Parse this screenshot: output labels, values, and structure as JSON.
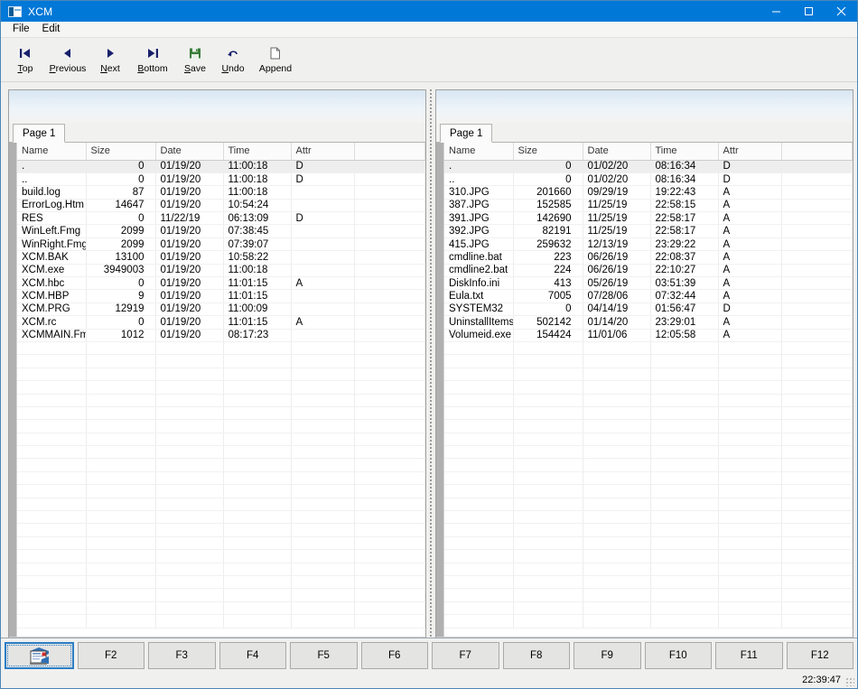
{
  "window": {
    "title": "XCM",
    "icon": "app-window-icon",
    "border_color": "#4a86b8",
    "titlebar_color": "#0078d7",
    "controls": [
      {
        "name": "minimize-button",
        "glyph": "minimize-icon"
      },
      {
        "name": "maximize-button",
        "glyph": "maximize-icon"
      },
      {
        "name": "close-button",
        "glyph": "close-icon"
      }
    ]
  },
  "menubar": {
    "items": [
      {
        "label": "File",
        "name": "menu-file"
      },
      {
        "label": "Edit",
        "name": "menu-edit"
      }
    ]
  },
  "toolbar": {
    "buttons": [
      {
        "label": "Top",
        "accel": "T",
        "icon": "first-page-icon"
      },
      {
        "label": "Previous",
        "accel": "P",
        "icon": "previous-icon"
      },
      {
        "label": "Next",
        "accel": "N",
        "icon": "next-icon"
      },
      {
        "label": "Bottom",
        "accel": "B",
        "icon": "last-page-icon"
      },
      {
        "label": "Save",
        "accel": "S",
        "icon": "floppy-save-icon"
      },
      {
        "label": "Undo",
        "accel": "U",
        "icon": "undo-icon"
      },
      {
        "label": "Append",
        "accel": "",
        "icon": "page-append-icon"
      }
    ]
  },
  "columns": [
    "Name",
    "Size",
    "Date",
    "Time",
    "Attr",
    ""
  ],
  "panels": [
    {
      "name": "left-file-panel",
      "tab": "Page 1",
      "rows": [
        {
          "name": ".",
          "size": "0",
          "date": "01/19/20",
          "time": "11:00:18",
          "attr": "D",
          "selected": true
        },
        {
          "name": "..",
          "size": "0",
          "date": "01/19/20",
          "time": "11:00:18",
          "attr": "D",
          "selected": false
        },
        {
          "name": "build.log",
          "size": "87",
          "date": "01/19/20",
          "time": "11:00:18",
          "attr": "",
          "selected": false
        },
        {
          "name": "ErrorLog.Htm",
          "size": "14647",
          "date": "01/19/20",
          "time": "10:54:24",
          "attr": "",
          "selected": false
        },
        {
          "name": "RES",
          "size": "0",
          "date": "11/22/19",
          "time": "06:13:09",
          "attr": "D",
          "selected": false
        },
        {
          "name": "WinLeft.Fmg",
          "size": "2099",
          "date": "01/19/20",
          "time": "07:38:45",
          "attr": "",
          "selected": false
        },
        {
          "name": "WinRight.Fmg",
          "size": "2099",
          "date": "01/19/20",
          "time": "07:39:07",
          "attr": "",
          "selected": false
        },
        {
          "name": "XCM.BAK",
          "size": "13100",
          "date": "01/19/20",
          "time": "10:58:22",
          "attr": "",
          "selected": false
        },
        {
          "name": "XCM.exe",
          "size": "3949003",
          "date": "01/19/20",
          "time": "11:00:18",
          "attr": "",
          "selected": false
        },
        {
          "name": "XCM.hbc",
          "size": "0",
          "date": "01/19/20",
          "time": "11:01:15",
          "attr": "A",
          "selected": false
        },
        {
          "name": "XCM.HBP",
          "size": "9",
          "date": "01/19/20",
          "time": "11:01:15",
          "attr": "",
          "selected": false
        },
        {
          "name": "XCM.PRG",
          "size": "12919",
          "date": "01/19/20",
          "time": "11:00:09",
          "attr": "",
          "selected": false
        },
        {
          "name": "XCM.rc",
          "size": "0",
          "date": "01/19/20",
          "time": "11:01:15",
          "attr": "A",
          "selected": false
        },
        {
          "name": "XCMMAIN.Fmg",
          "size": "1012",
          "date": "01/19/20",
          "time": "08:17:23",
          "attr": "",
          "selected": false
        }
      ]
    },
    {
      "name": "right-file-panel",
      "tab": "Page 1",
      "rows": [
        {
          "name": ".",
          "size": "0",
          "date": "01/02/20",
          "time": "08:16:34",
          "attr": "D",
          "selected": true
        },
        {
          "name": "..",
          "size": "0",
          "date": "01/02/20",
          "time": "08:16:34",
          "attr": "D",
          "selected": false
        },
        {
          "name": "310.JPG",
          "size": "201660",
          "date": "09/29/19",
          "time": "19:22:43",
          "attr": "A",
          "selected": false
        },
        {
          "name": "387.JPG",
          "size": "152585",
          "date": "11/25/19",
          "time": "22:58:15",
          "attr": "A",
          "selected": false
        },
        {
          "name": "391.JPG",
          "size": "142690",
          "date": "11/25/19",
          "time": "22:58:17",
          "attr": "A",
          "selected": false
        },
        {
          "name": "392.JPG",
          "size": "82191",
          "date": "11/25/19",
          "time": "22:58:17",
          "attr": "A",
          "selected": false
        },
        {
          "name": "415.JPG",
          "size": "259632",
          "date": "12/13/19",
          "time": "23:29:22",
          "attr": "A",
          "selected": false
        },
        {
          "name": "cmdline.bat",
          "size": "223",
          "date": "06/26/19",
          "time": "22:08:37",
          "attr": "A",
          "selected": false
        },
        {
          "name": "cmdline2.bat",
          "size": "224",
          "date": "06/26/19",
          "time": "22:10:27",
          "attr": "A",
          "selected": false
        },
        {
          "name": "DiskInfo.ini",
          "size": "413",
          "date": "05/26/19",
          "time": "03:51:39",
          "attr": "A",
          "selected": false
        },
        {
          "name": "Eula.txt",
          "size": "7005",
          "date": "07/28/06",
          "time": "07:32:44",
          "attr": "A",
          "selected": false
        },
        {
          "name": "SYSTEM32",
          "size": "0",
          "date": "04/14/19",
          "time": "01:56:47",
          "attr": "D",
          "selected": false
        },
        {
          "name": "UninstallItems.I...",
          "size": "502142",
          "date": "01/14/20",
          "time": "23:29:01",
          "attr": "A",
          "selected": false
        },
        {
          "name": "Volumeid.exe",
          "size": "154424",
          "date": "11/01/06",
          "time": "12:05:58",
          "attr": "A",
          "selected": false
        }
      ]
    }
  ],
  "empty_row_count": 22,
  "function_keys": [
    {
      "label": "",
      "name": "fkey-f1",
      "icon": "window-refresh-icon",
      "focused": true
    },
    {
      "label": "F2",
      "name": "fkey-f2",
      "icon": "",
      "focused": false
    },
    {
      "label": "F3",
      "name": "fkey-f3",
      "icon": "",
      "focused": false
    },
    {
      "label": "F4",
      "name": "fkey-f4",
      "icon": "",
      "focused": false
    },
    {
      "label": "F5",
      "name": "fkey-f5",
      "icon": "",
      "focused": false
    },
    {
      "label": "F6",
      "name": "fkey-f6",
      "icon": "",
      "focused": false
    },
    {
      "label": "F7",
      "name": "fkey-f7",
      "icon": "",
      "focused": false
    },
    {
      "label": "F8",
      "name": "fkey-f8",
      "icon": "",
      "focused": false
    },
    {
      "label": "F9",
      "name": "fkey-f9",
      "icon": "",
      "focused": false
    },
    {
      "label": "F10",
      "name": "fkey-f10",
      "icon": "",
      "focused": false
    },
    {
      "label": "F11",
      "name": "fkey-f11",
      "icon": "",
      "focused": false
    },
    {
      "label": "F12",
      "name": "fkey-f12",
      "icon": "",
      "focused": false
    }
  ],
  "statusbar": {
    "clock": "22:39:47"
  }
}
